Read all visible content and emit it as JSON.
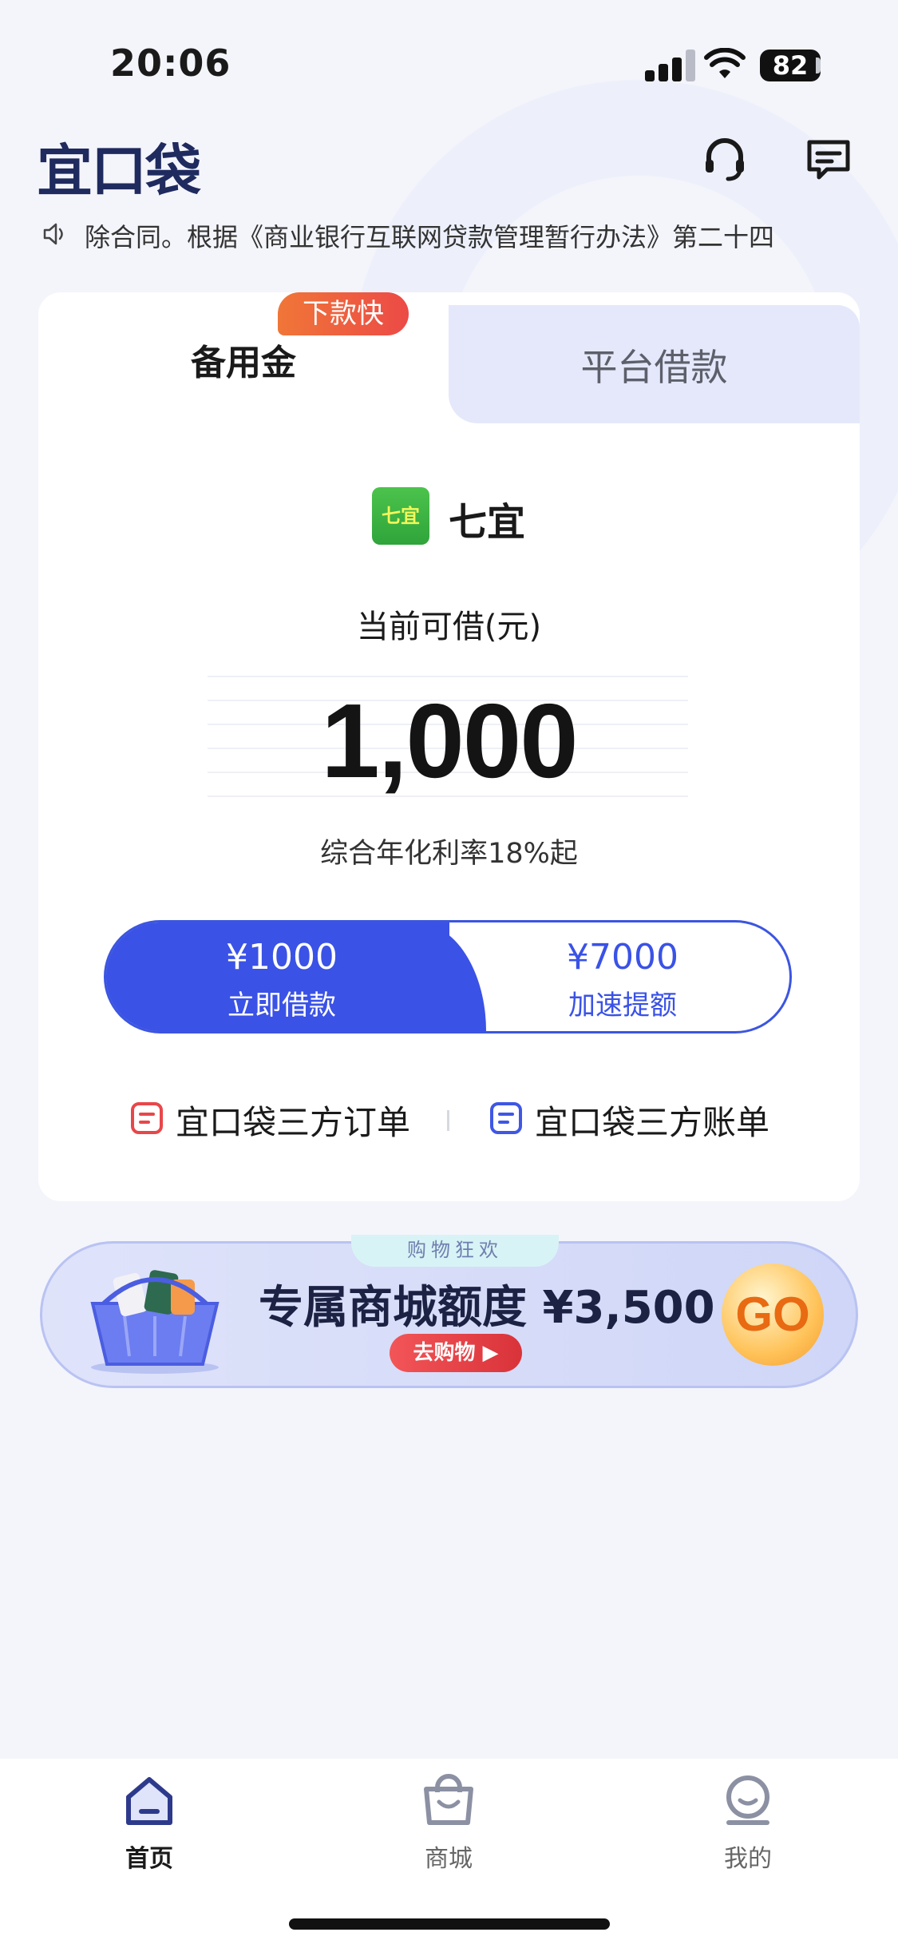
{
  "status_bar": {
    "time": "20:06",
    "battery": "82"
  },
  "header": {
    "logo": "宜口袋",
    "icons": [
      "headset-icon",
      "message-icon"
    ]
  },
  "notice": {
    "icon": "speaker-icon",
    "text": "除合同。根据《商业银行互联网贷款管理暂行办法》第二十四"
  },
  "card": {
    "tabs": [
      {
        "label": "备用金",
        "active": true,
        "badge": "下款快"
      },
      {
        "label": "平台借款",
        "active": false
      }
    ],
    "partner": {
      "logo_text": "七宜",
      "name": "七宜"
    },
    "available_label": "当前可借(元)",
    "amount": "1,000",
    "rate": "综合年化利率18%起",
    "buttons": {
      "primary": {
        "value": "¥1000",
        "label": "立即借款"
      },
      "secondary": {
        "value": "¥7000",
        "label": "加速提额"
      }
    },
    "links": [
      {
        "label": "宜口袋三方订单",
        "color": "#e8474a"
      },
      {
        "label": "宜口袋三方账单",
        "color": "#3f57e4"
      }
    ]
  },
  "banner": {
    "tag": "购物狂欢",
    "title": "专属商城额度 ¥3,500",
    "button": "去购物 ▶",
    "go": "GO"
  },
  "tabbar": {
    "items": [
      {
        "label": "首页",
        "icon": "home-icon",
        "active": true
      },
      {
        "label": "商城",
        "icon": "shopping-bag-icon",
        "active": false
      },
      {
        "label": "我的",
        "icon": "profile-icon",
        "active": false
      }
    ]
  },
  "colors": {
    "accent": "#3a52e6",
    "badge": "#ec4a46",
    "background": "#f4f5fb"
  }
}
